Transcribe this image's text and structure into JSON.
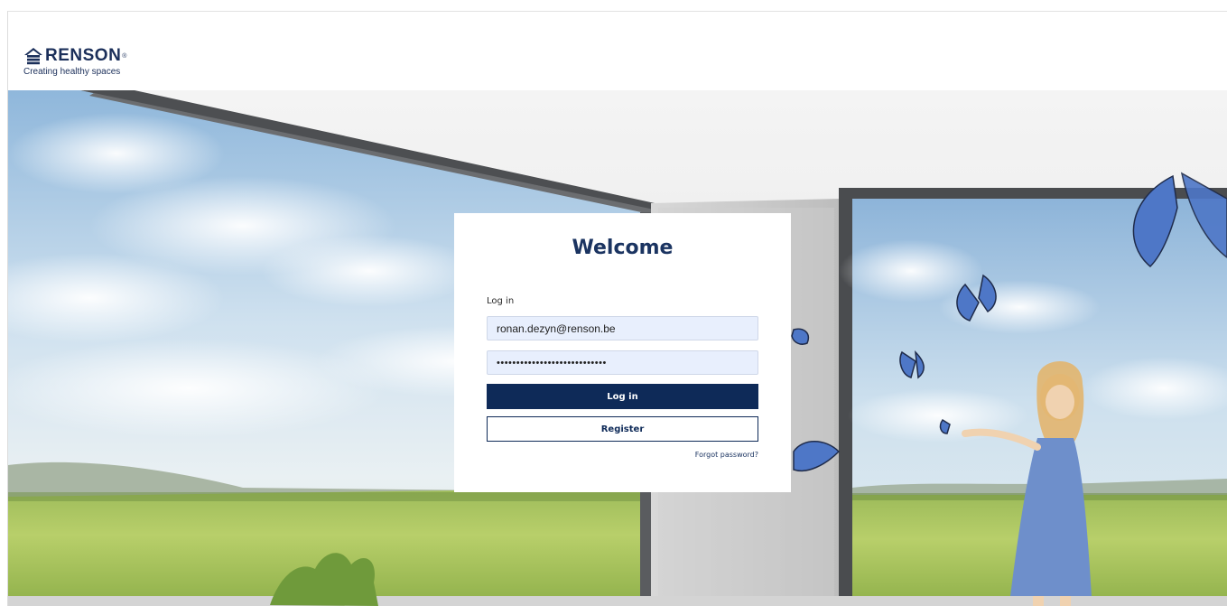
{
  "header": {
    "logo_text": "RENSON",
    "logo_registered": "®",
    "tagline": "Creating healthy spaces"
  },
  "login_card": {
    "title": "Welcome",
    "section_label": "Log in",
    "email_value": "ronan.dezyn@renson.be",
    "password_value": "••••••••••••••••••••••••••••",
    "login_button": "Log in",
    "register_button": "Register",
    "forgot_password_link": "Forgot password?"
  },
  "colors": {
    "brand_navy": "#0e2a58",
    "input_fill": "#e8effd"
  }
}
